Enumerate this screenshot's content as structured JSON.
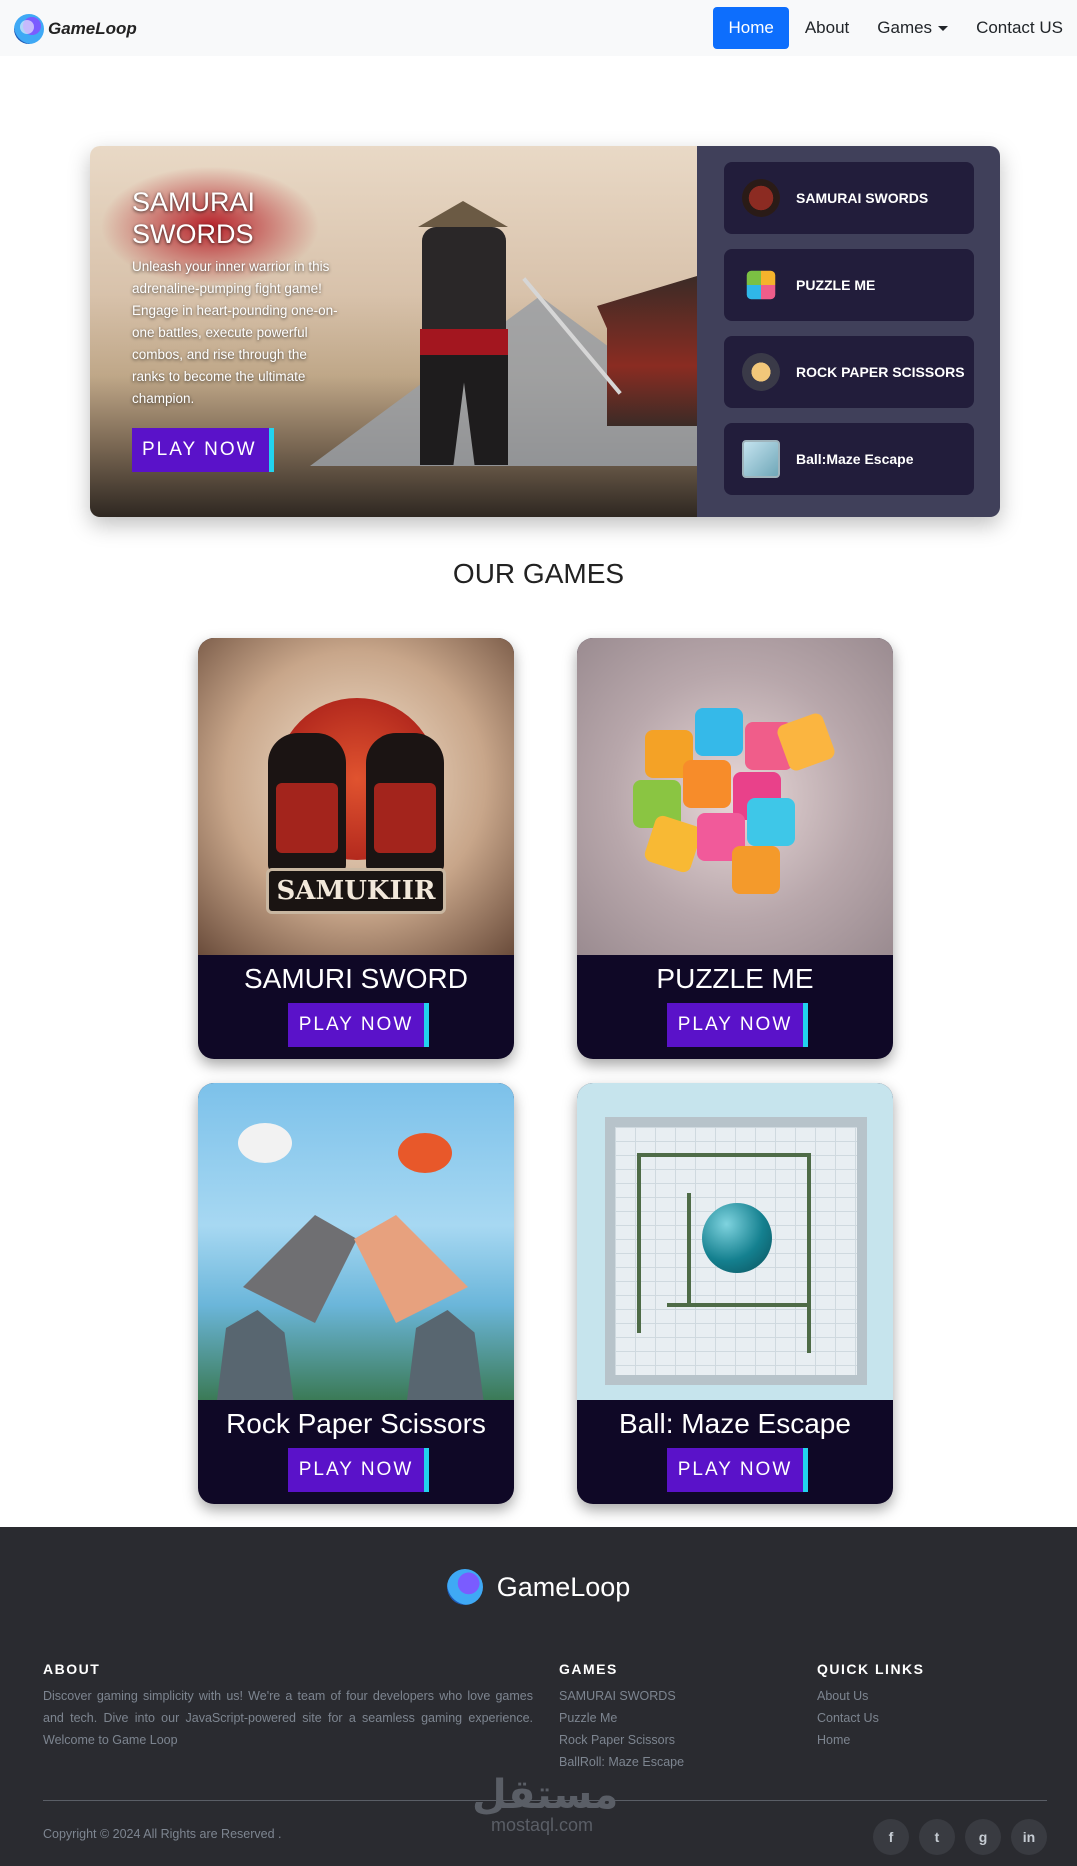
{
  "navbar": {
    "brand": "GameLoop",
    "links": [
      {
        "label": "Home",
        "active": true
      },
      {
        "label": "About"
      },
      {
        "label": "Games",
        "dropdown": true
      },
      {
        "label": "Contact US"
      }
    ]
  },
  "hero": {
    "title": "SAMURAI SWORDS",
    "description": "Unleash your inner warrior in this adrenaline-pumping fight game! Engage in heart-pounding one-on-one battles, execute powerful combos, and rise through the ranks to become the ultimate champion.",
    "button": "PLAY NOW",
    "list": [
      {
        "label": "SAMURAI SWORDS",
        "icon": "samurai-thumb-icon"
      },
      {
        "label": "PUZZLE ME",
        "icon": "puzzle-thumb-icon"
      },
      {
        "label": "ROCK PAPER SCISSORS",
        "icon": "rps-thumb-icon"
      },
      {
        "label": "Ball:Maze Escape",
        "icon": "maze-thumb-icon"
      }
    ]
  },
  "section": {
    "title": "OUR GAMES"
  },
  "cards": [
    {
      "name": "SAMURI SWORD",
      "button": "PLAY NOW",
      "art_text": "SAMUKIIR"
    },
    {
      "name": "PUZZLE ME",
      "button": "PLAY NOW"
    },
    {
      "name": "Rock Paper Scissors",
      "button": "PLAY NOW"
    },
    {
      "name": "Ball: Maze Escape",
      "button": "PLAY NOW"
    }
  ],
  "footer": {
    "brand": "GameLoop",
    "about": {
      "heading": "ABOUT",
      "text": "Discover gaming simplicity with us! We're a team of four developers who love games and tech. Dive into our JavaScript-powered site for a seamless gaming experience. Welcome to Game Loop"
    },
    "games": {
      "heading": "GAMES",
      "items": [
        "SAMURAI SWORDS",
        "Puzzle Me",
        "Rock Paper Scissors",
        "BallRoll: Maze Escape"
      ]
    },
    "quick_links": {
      "heading": "QUICK LINKS",
      "items": [
        "About Us",
        "Contact Us",
        "Home"
      ]
    },
    "copyright": "Copyright © 2024 All Rights are Reserved .",
    "watermark": {
      "arabic": "مستقل",
      "latin": "mostaql.com"
    },
    "socials": [
      {
        "icon": "facebook-icon",
        "glyph": "f"
      },
      {
        "icon": "twitter-icon",
        "glyph": "t"
      },
      {
        "icon": "github-icon",
        "glyph": "g"
      },
      {
        "icon": "linkedin-icon",
        "glyph": "in"
      }
    ]
  },
  "colors": {
    "accent": "#0d6efd",
    "play_button": "#5a12c9",
    "play_button_edge": "#22d3ee",
    "hero_panel": "#40405a",
    "hero_item": "#221d3b",
    "card_footer": "#0f0826",
    "footer_bg": "#2a2b30"
  }
}
